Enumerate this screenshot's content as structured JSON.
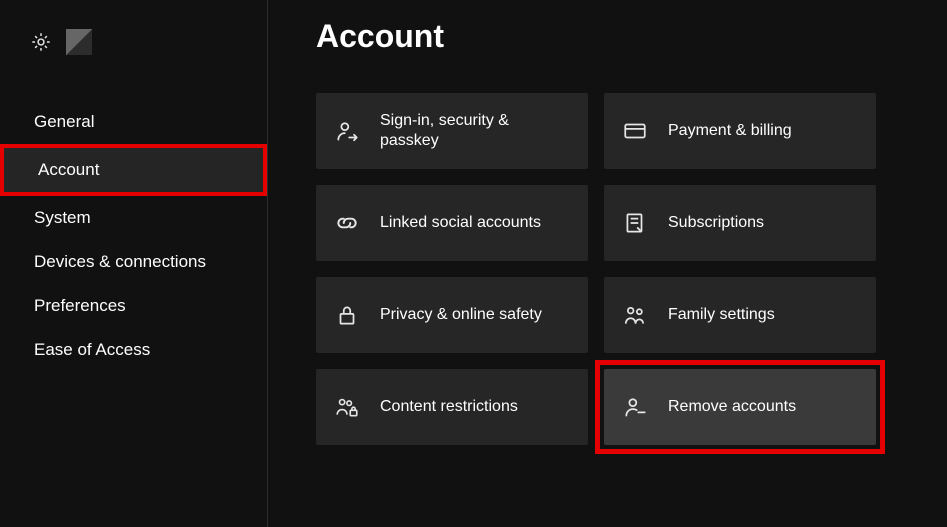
{
  "sidebar": {
    "items": [
      {
        "label": "General"
      },
      {
        "label": "Account"
      },
      {
        "label": "System"
      },
      {
        "label": "Devices & connections"
      },
      {
        "label": "Preferences"
      },
      {
        "label": "Ease of Access"
      }
    ],
    "selected_index": 1,
    "highlighted_index": 1
  },
  "page": {
    "title": "Account"
  },
  "tiles": [
    {
      "icon": "person-arrow-icon",
      "label": "Sign-in, security & passkey"
    },
    {
      "icon": "credit-card-icon",
      "label": "Payment & billing"
    },
    {
      "icon": "link-icon",
      "label": "Linked social accounts"
    },
    {
      "icon": "receipt-icon",
      "label": "Subscriptions"
    },
    {
      "icon": "lock-icon",
      "label": "Privacy & online safety"
    },
    {
      "icon": "family-icon",
      "label": "Family settings"
    },
    {
      "icon": "people-lock-icon",
      "label": "Content restrictions"
    },
    {
      "icon": "person-remove-icon",
      "label": "Remove accounts"
    }
  ],
  "highlighted_tile_index": 7,
  "colors": {
    "highlight": "#e50000",
    "tile_bg": "#262626",
    "selected_bg": "#252525"
  }
}
